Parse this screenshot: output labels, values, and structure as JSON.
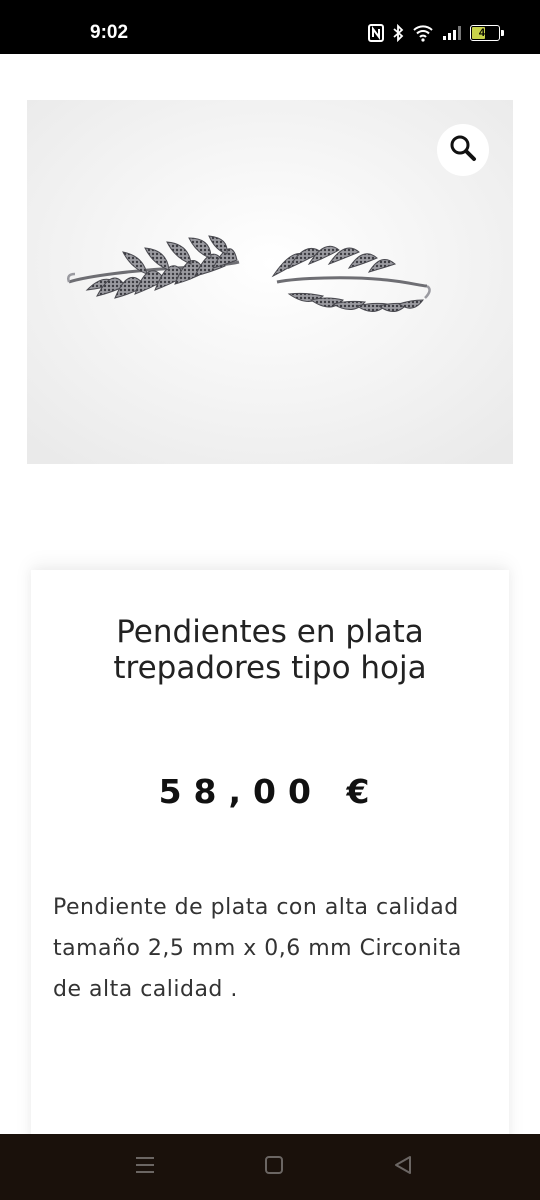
{
  "status_bar": {
    "time": "9:02",
    "icons": [
      "nfc-icon",
      "bluetooth-icon",
      "wifi-icon",
      "signal-icon"
    ],
    "battery": "45"
  },
  "product": {
    "image_alt": "Pendientes en plata trepadores tipo hoja",
    "title": "Pendientes en plata trepadores tipo hoja",
    "price": "58,00 €",
    "description": "Pendiente de plata con alta calidad tamaño 2,5 mm x 0,6 mm Circonita de alta calidad ."
  },
  "nav_bar": {
    "icons": [
      "menu-icon",
      "home-icon",
      "back-icon"
    ]
  },
  "colors": {
    "status_bg": "#000000",
    "nav_bg": "#1a110b",
    "text": "#222222"
  }
}
